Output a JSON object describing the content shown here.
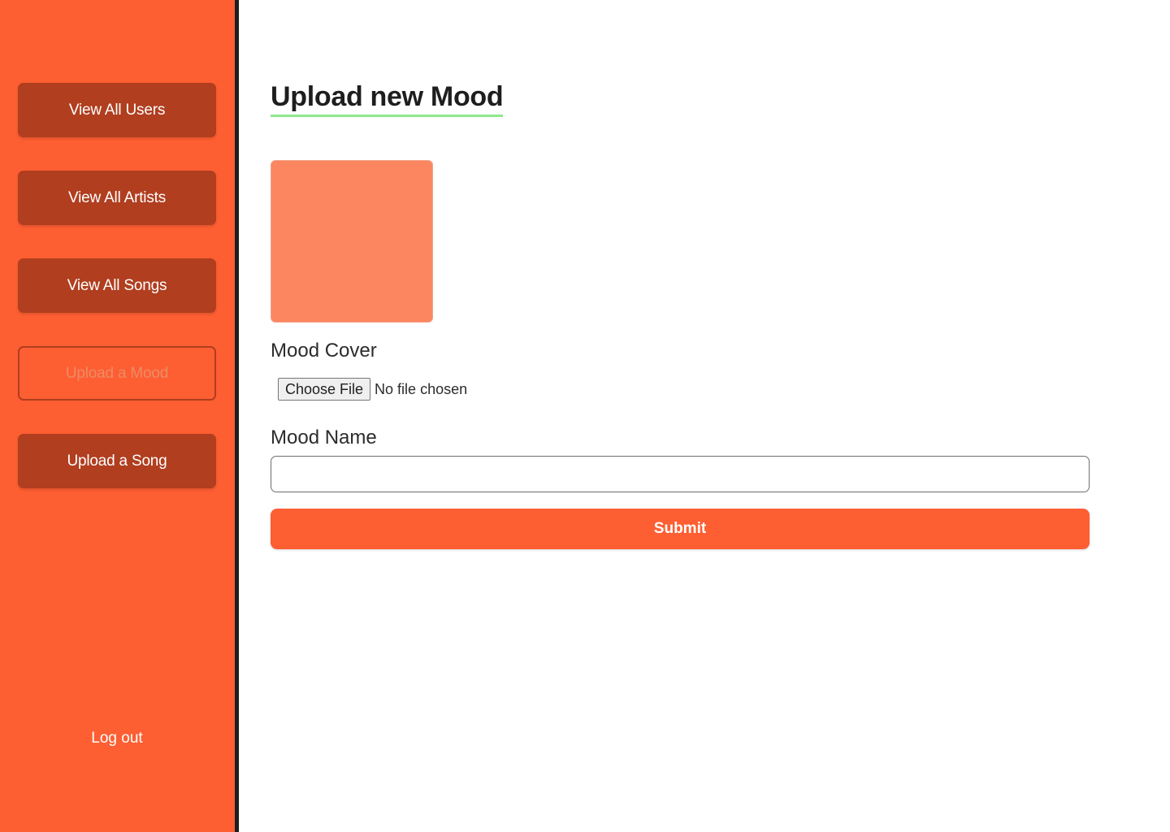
{
  "sidebar": {
    "items": [
      {
        "label": "View All Users",
        "active": false
      },
      {
        "label": "View All Artists",
        "active": false
      },
      {
        "label": "View All Songs",
        "active": false
      },
      {
        "label": "Upload a Mood",
        "active": true
      },
      {
        "label": "Upload a Song",
        "active": false
      }
    ],
    "logout_label": "Log out"
  },
  "main": {
    "title": "Upload new Mood",
    "cover_label": "Mood Cover",
    "file_button_label": "Choose File",
    "file_status": "No file chosen",
    "name_label": "Mood Name",
    "name_value": "",
    "submit_label": "Submit"
  },
  "colors": {
    "accent": "#fd5e32",
    "sidebar_button": "#b03e1f",
    "cover_preview": "#fc8660",
    "title_underline": "#8ee88a"
  }
}
